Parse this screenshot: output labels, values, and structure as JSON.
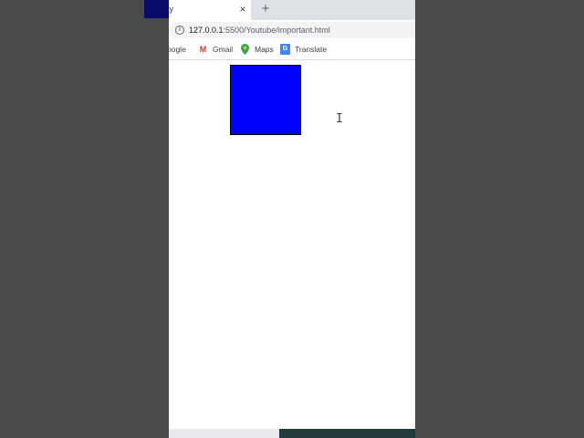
{
  "browser": {
    "tab": {
      "title": "ty",
      "close_glyph": "×"
    },
    "new_tab_glyph": "+",
    "address_bar": {
      "info_glyph": "i",
      "host": "127.0.0.1",
      "path": ":5500/Youtube/important.html"
    },
    "bookmarks": [
      {
        "label": "oogle",
        "icon": ""
      },
      {
        "label": "Gmail",
        "icon": "gmail-icon",
        "glyph": "M"
      },
      {
        "label": "Maps",
        "icon": "maps-icon",
        "glyph": "⬤"
      },
      {
        "label": "Translate",
        "icon": "translate-icon",
        "glyph": "G"
      }
    ]
  },
  "page": {
    "box_color": "#0000ff",
    "cursor_glyph": "I"
  },
  "colors": {
    "desktop_background": "#4a4a4a",
    "left_tile": "#0a0a6b",
    "box_fill": "#0000ff"
  }
}
